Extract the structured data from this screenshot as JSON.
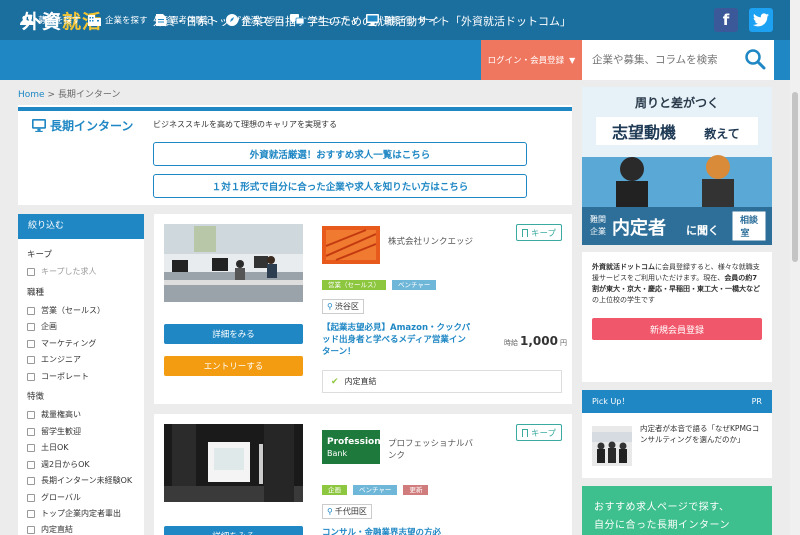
{
  "header": {
    "logo_part1": "外資",
    "logo_part2": "就活",
    "tagline": "外資・日系トップ企業を目指す学生のための就職活動サイト「外資就活ドットコム」",
    "facebook_label": "f",
    "twitter_label": "t"
  },
  "nav": {
    "items": [
      {
        "label": "募集を探す",
        "icon": "users-icon"
      },
      {
        "label": "企業を探す",
        "icon": "building-icon"
      },
      {
        "label": "選考体験記",
        "icon": "document-icon"
      },
      {
        "label": "就活コラム",
        "icon": "rocket-icon"
      },
      {
        "label": "コミュニティ",
        "icon": "chat-icon"
      },
      {
        "label": "長期インターン",
        "icon": "monitor-icon"
      }
    ],
    "login_label": "ログイン・会員登録",
    "search_placeholder": "企業や募集、コラムを検索"
  },
  "breadcrumb": {
    "home": "Home",
    "separator": ">",
    "current": "長期インターン"
  },
  "page": {
    "title": "長期インターン",
    "subtitle": "ビジネススキルを高めて理想のキャリアを実現する",
    "banner1": "外資就活厳選！おすすめ求人一覧はこちら",
    "banner2": "１対１形式で自分に合った企業や求人を知りたい方はこちら"
  },
  "filter": {
    "title": "絞り込む",
    "groups": [
      {
        "label": "キープ",
        "items": [
          "キープした求人"
        ]
      },
      {
        "label": "職種",
        "items": [
          "営業（セールス）",
          "企画",
          "マーケティング",
          "エンジニア",
          "コーポレート"
        ]
      },
      {
        "label": "特徴",
        "items": [
          "裁量権高い",
          "留学生歓迎",
          "土日OK",
          "週2日からOK",
          "長期インターン未経験OK",
          "グローバル",
          "トップ企業内定者輩出",
          "内定直結"
        ]
      }
    ]
  },
  "cards": [
    {
      "company": "株式会社リンクエッジ",
      "tags": [
        "営業（セールス）",
        "ベンチャー"
      ],
      "location": "渋谷区",
      "title": "【起業志望必見】Amazon・クックパッド出身者と学べるメディア営業インターン！",
      "wage_label": "時給",
      "wage_value": "1,000",
      "wage_unit": "円",
      "feature": "内定直結",
      "detail_label": "詳細をみる",
      "entry_label": "エントリーする",
      "keep_label": "キープ"
    },
    {
      "company": "プロフェッショナルバンク",
      "logo_text_1": "Professional",
      "logo_text_2": "Bank",
      "tags": [
        "企画",
        "ベンチャー",
        "更新"
      ],
      "location": "千代田区",
      "title": "コンサル・金融業界志望の方必",
      "detail_label": "詳細をみる",
      "keep_label": "キープ"
    }
  ],
  "sidebar": {
    "ad_line1": "周りと差がつく",
    "ad_line2": "志望動機",
    "ad_line2b": "教えて",
    "ad_line3a": "難関",
    "ad_line3b": "企業",
    "ad_line3c": "内定者",
    "ad_line3d": "に聞く",
    "ad_badge1": "相談",
    "ad_badge2": "室",
    "info_part1": "外資就活ドットコム",
    "info_part2": "に会員登録すると、様々な就職支援サービスをご利用いただけます。現在、",
    "info_part3": "会員の約7割が東大・京大・慶応・早稲田・東工大・一橋大など",
    "info_part4": "の上位校の学生です",
    "register_label": "新規会員登録",
    "pickup_title": "Pick Up！",
    "pickup_pr": "PR",
    "pickup_text": "内定者が本音で語る「なぜKPMGコンサルティングを選んだのか」",
    "bottom_line1": "おすすめ求人ページで探す、",
    "bottom_line2": "自分に合った長期インターン"
  },
  "colors": {
    "brand": "#1f87c4",
    "header": "#1b6f9f",
    "login": "#f0775f",
    "entry": "#f39c12",
    "register": "#f0576a",
    "keep": "#3aa99f"
  }
}
